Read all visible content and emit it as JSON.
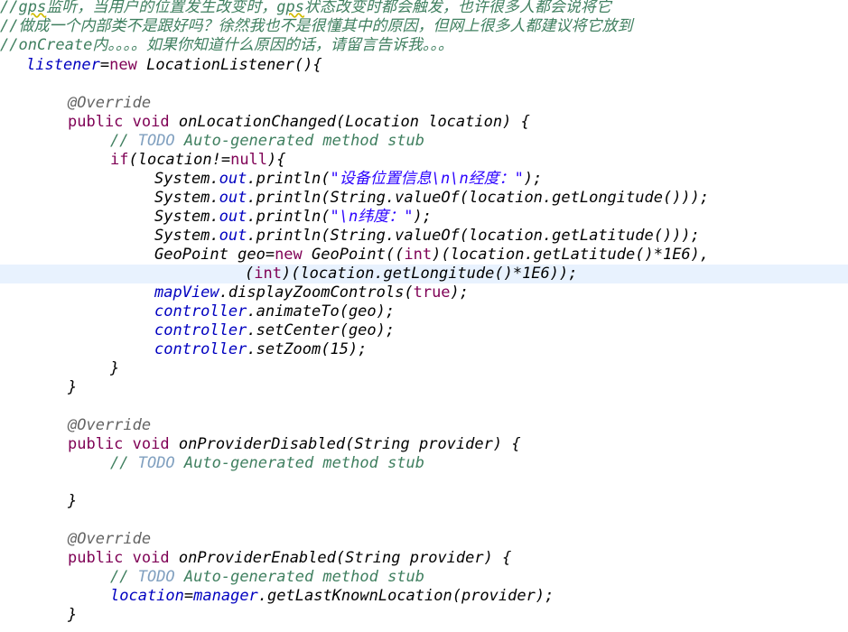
{
  "editor": {
    "comment_line1_a": "//",
    "comment_line1_b": "gps",
    "comment_line1_c": "监听，当用户的位置发生改变时，",
    "comment_line1_d": "gps",
    "comment_line1_e": "状态改变时都会触发，也许很多人都会说将它",
    "comment_line2": "//做成一个内部类不是跟好吗？徐然我也不是很懂其中的原因，但网上很多人都建议将它放到",
    "comment_line3": "//onCreate内。。。。如果你知道什么原因的话，请留言告诉我。。。",
    "listener": {
      "var": "listener",
      "op": "=",
      "kw_new": "new",
      "rest": " LocationListener(){"
    },
    "annotation": "@Override",
    "kw_public": "public",
    "kw_void": "void",
    "todo_slashes": "// ",
    "todo_word": "TODO",
    "todo_rest": " Auto-generated method stub",
    "closing_brace": "}",
    "method1": {
      "signature": "onLocationChanged(Location location) {",
      "kw_if": "if",
      "if_a": "(location!=",
      "kw_null": "null",
      "if_b": "){",
      "system": "System.",
      "out": "out",
      "println_open": ".println(",
      "str_info": "\"设备位置信息\\n\\n经度：\"",
      "stmt_end": ");",
      "string_prefix": ".println(String.",
      "valueof": "valueOf",
      "lon_arg": "(location.getLongitude()));",
      "str_lat": "\"\\n纬度：\"",
      "lat_arg": "(location.getLatitude()));",
      "geo_a": "GeoPoint geo=",
      "kw_new": "new",
      "geo_b": " GeoPoint((",
      "kw_int": "int",
      "geo_c": ")(location.getLatitude()*1E6),",
      "geo_d": "(",
      "geo_e": ")(location.getLongitude()*1E6));",
      "mapview": "mapView",
      "zoom_controls": ".displayZoomControls(",
      "kw_true": "true",
      "controller": "controller",
      "animate": ".animateTo(geo);",
      "set_center": ".setCenter(geo);",
      "set_zoom": ".setZoom(15);"
    },
    "method2": {
      "signature": "onProviderDisabled(String provider) {"
    },
    "method3": {
      "signature": "onProviderEnabled(String provider) {",
      "location_var": "location",
      "op": "=",
      "manager_var": "manager",
      "call": ".getLastKnownLocation(provider);"
    }
  }
}
